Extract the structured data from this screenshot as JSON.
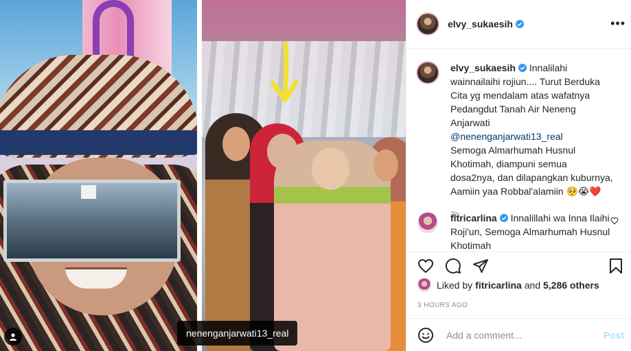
{
  "post": {
    "photo_tag_username": "nenenganjarwati13_real"
  },
  "header": {
    "username": "elvy_sukaesih",
    "more_glyph": "•••"
  },
  "caption": {
    "username": "elvy_sukaesih",
    "text_line1": "Innalilahi wainnailaihi rojiun.... Turut Berduka Cita yg mendalam atas wafatnya Pedangdut Tanah Air Neneng Anjarwati",
    "mention": "@nenenganjarwati13_real",
    "text_line2": "Semoga Almarhumah Husnul Khotimah, diampuni semua dosa2nya, dan dilapangkan kuburnya, Aamiin yaa Robbal'alamiin",
    "emojis": "🥺😭❤️",
    "time": "3h"
  },
  "comment_2": {
    "username": "fitricarlina",
    "text": "Innalillahi wa Inna Ilaihi Roji'un, Semoga Almarhumah Husnul Khotimah"
  },
  "likes": {
    "prefix": "Liked by ",
    "user": "fitricarlina",
    "middle": " and ",
    "count": "5,286 others"
  },
  "timestamp": "3 HOURS AGO",
  "add_comment": {
    "placeholder": "Add a comment...",
    "post_label": "Post"
  },
  "colors": {
    "verified_blue": "#3897f0",
    "link_blue": "#00376b",
    "post_disabled": "#b2dffc",
    "arrow_yellow": "#f3e034"
  }
}
